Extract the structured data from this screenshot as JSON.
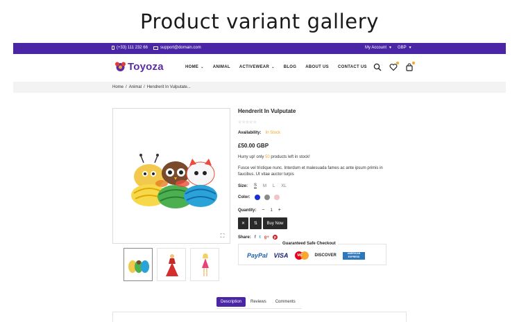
{
  "banner": {
    "title": "Product variant gallery"
  },
  "topbar": {
    "phone": "(+33) 111 232 66",
    "email": "support@domain.com",
    "account": "My Account",
    "currency": "GBP",
    "bg_color": "#4a25a5"
  },
  "header": {
    "logo_text": "Toyoza",
    "nav": [
      "HOME",
      "ANIMAL",
      "ACTIVEWEAR",
      "BLOG",
      "ABOUT US",
      "CONTACT US"
    ],
    "icons": [
      "search-icon",
      "heart-icon",
      "cart-icon"
    ]
  },
  "breadcrumb": {
    "items": [
      "Home",
      "Animal",
      "Hendrerit In Vulputate..."
    ],
    "separator": "/"
  },
  "product": {
    "title": "Hendrerit In Vulputate",
    "stars": "☆☆☆☆☆",
    "availability_label": "Availability:",
    "availability_value": "In Stock",
    "price": "£50.00 GBP",
    "hurry_prefix": "Hurry up! only",
    "hurry_count": "50",
    "hurry_suffix": "products left in stock!",
    "description": "Fusce vel tristique nunc. Interdum et malesuada fames ac ante ipsum primis in faucibus. Ut vitae auctor turpis",
    "size_label": "Size:",
    "sizes": [
      "S",
      "M",
      "L",
      "XL"
    ],
    "selected_size": "S",
    "color_label": "Color:",
    "colors": [
      "#1a2fd6",
      "#8a8a8a",
      "#f4c3c8"
    ],
    "quantity_label": "Quantity:",
    "quantity": "1",
    "qty_minus": "−",
    "qty_plus": "+",
    "remove_btn": "✕",
    "compare_btn": "⇅",
    "buy_now": "Buy Now",
    "share_label": "Share:",
    "share_icons": [
      "f",
      "t",
      "g+",
      "p"
    ],
    "zoom": "⛶"
  },
  "checkout": {
    "title": "Guaranteed Safe Checkout",
    "logos": [
      "PayPal",
      "VISA",
      "MC",
      "DISCOVER",
      "AMERICAN EXPRESS"
    ]
  },
  "tabs": [
    "Description",
    "Reviews",
    "Comments"
  ]
}
